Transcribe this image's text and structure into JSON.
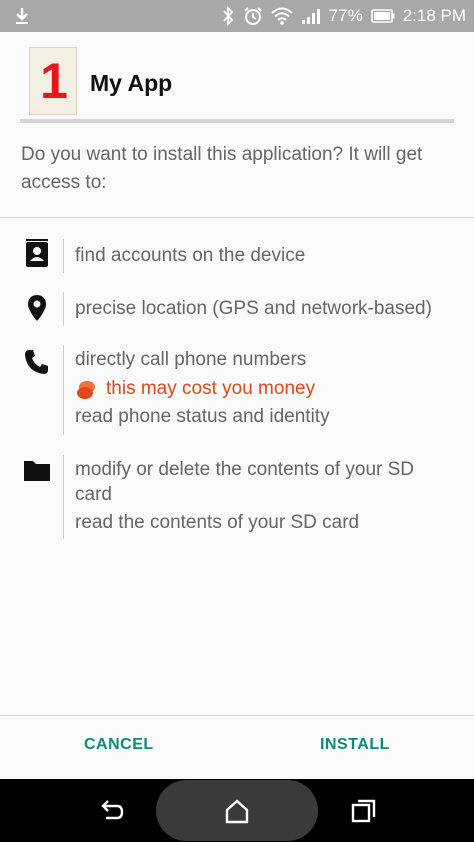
{
  "status_bar": {
    "battery": "77%",
    "time": "2:18 PM"
  },
  "app": {
    "logo_text": "1",
    "name": "My App"
  },
  "prompt": "Do you want to install this application? It will get access to:",
  "permissions": {
    "accounts": {
      "icon": "contacts-icon",
      "lines": [
        "find accounts on the device"
      ]
    },
    "location": {
      "icon": "location-pin-icon",
      "lines": [
        "precise location (GPS and network-based)"
      ]
    },
    "phone": {
      "icon": "phone-icon",
      "lines": [
        "directly call phone numbers"
      ],
      "warning": "this may cost you money",
      "lines_after": [
        "read phone status and identity"
      ]
    },
    "storage": {
      "icon": "folder-icon",
      "lines": [
        "modify or delete the contents of your SD",
        "card",
        "read the contents of your SD card"
      ]
    }
  },
  "buttons": {
    "cancel": "CANCEL",
    "install": "INSTALL"
  },
  "colors": {
    "accent": "#10897d",
    "warning": "#e0471b",
    "status_bar": "#a8a8a8"
  }
}
